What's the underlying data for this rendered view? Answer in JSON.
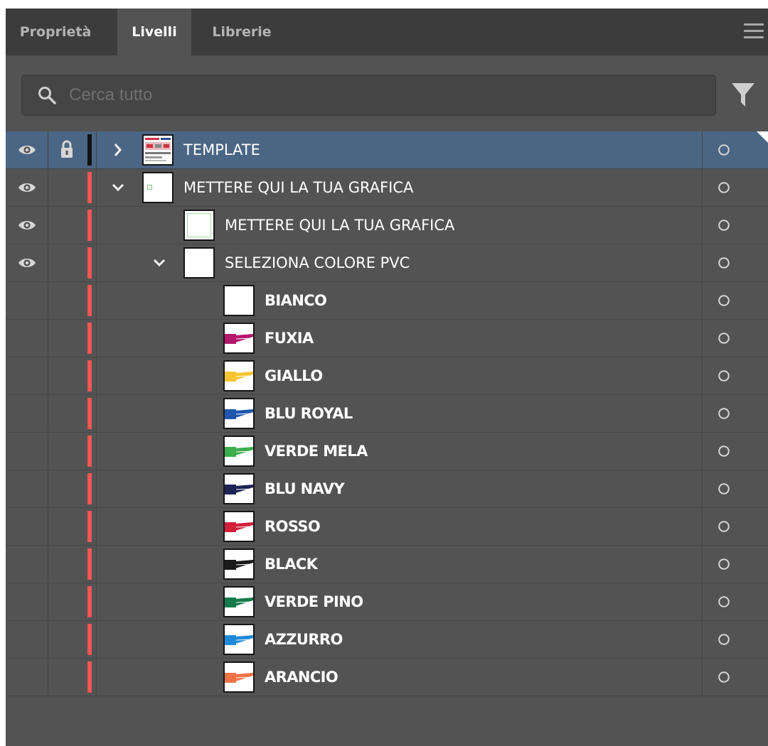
{
  "tabs": [
    {
      "label": "Proprietà",
      "active": false
    },
    {
      "label": "Livelli",
      "active": true
    },
    {
      "label": "Librerie",
      "active": false
    }
  ],
  "icons": {
    "menu": "hamburger-menu-icon",
    "search": "search-icon",
    "filter": "filter-funnel-icon",
    "eye": "eye-icon",
    "lock": "lock-icon",
    "chevron_right": "chevron-right-icon",
    "chevron_down": "chevron-down-icon",
    "target": "target-circle-icon"
  },
  "search": {
    "placeholder": "Cerca tutto",
    "value": ""
  },
  "colors": {
    "panel_bg": "#535353",
    "tabbar_bg": "#3c3c3c",
    "selected_row": "#4b6584",
    "layer_color": "#ef5656",
    "template_color": "#111111"
  },
  "layers": [
    {
      "label": "TEMPLATE",
      "level": 0,
      "visible": true,
      "locked": true,
      "expanded": false,
      "has_chevron": true,
      "selected": true,
      "thumb": "template"
    },
    {
      "label": "METTERE QUI LA TUA GRAFICA",
      "level": 0,
      "visible": true,
      "locked": false,
      "expanded": true,
      "has_chevron": true,
      "selected": false,
      "thumb": "artboard"
    },
    {
      "label": "METTERE QUI LA TUA GRAFICA",
      "level": 1,
      "visible": true,
      "locked": false,
      "has_chevron": false,
      "selected": false,
      "thumb": "frame"
    },
    {
      "label": "SELEZIONA COLORE PVC",
      "level": 1,
      "visible": true,
      "locked": false,
      "expanded": true,
      "has_chevron": true,
      "selected": false,
      "thumb": "blank"
    },
    {
      "label": "BIANCO",
      "level": 2,
      "visible": false,
      "locked": false,
      "has_chevron": false,
      "selected": false,
      "thumb": "blank",
      "swatch": "#ffffff"
    },
    {
      "label": "FUXIA",
      "level": 2,
      "visible": false,
      "locked": false,
      "has_chevron": false,
      "selected": false,
      "thumb": "swatch",
      "swatch": "#b5176b"
    },
    {
      "label": "GIALLO",
      "level": 2,
      "visible": false,
      "locked": false,
      "has_chevron": false,
      "selected": false,
      "thumb": "swatch",
      "swatch": "#f6c531"
    },
    {
      "label": "BLU ROYAL",
      "level": 2,
      "visible": false,
      "locked": false,
      "has_chevron": false,
      "selected": false,
      "thumb": "swatch",
      "swatch": "#1f57ad"
    },
    {
      "label": "VERDE MELA",
      "level": 2,
      "visible": false,
      "locked": false,
      "has_chevron": false,
      "selected": false,
      "thumb": "swatch",
      "swatch": "#3cae4e"
    },
    {
      "label": "BLU NAVY",
      "level": 2,
      "visible": false,
      "locked": false,
      "has_chevron": false,
      "selected": false,
      "thumb": "swatch",
      "swatch": "#1b2455"
    },
    {
      "label": "ROSSO",
      "level": 2,
      "visible": false,
      "locked": false,
      "has_chevron": false,
      "selected": false,
      "thumb": "swatch",
      "swatch": "#d21f3c"
    },
    {
      "label": "BLACK",
      "level": 2,
      "visible": false,
      "locked": false,
      "has_chevron": false,
      "selected": false,
      "thumb": "swatch",
      "swatch": "#1a1a1a"
    },
    {
      "label": "VERDE PINO",
      "level": 2,
      "visible": false,
      "locked": false,
      "has_chevron": false,
      "selected": false,
      "thumb": "swatch",
      "swatch": "#157a49"
    },
    {
      "label": "AZZURRO",
      "level": 2,
      "visible": false,
      "locked": false,
      "has_chevron": false,
      "selected": false,
      "thumb": "swatch",
      "swatch": "#1f8ad8"
    },
    {
      "label": "ARANCIO",
      "level": 2,
      "visible": false,
      "locked": false,
      "has_chevron": false,
      "selected": false,
      "thumb": "swatch",
      "swatch": "#f07245"
    }
  ]
}
